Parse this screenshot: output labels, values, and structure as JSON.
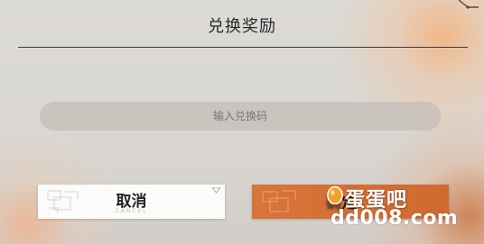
{
  "dialog": {
    "title": "兑换奖励",
    "code_input": {
      "value": "",
      "placeholder": "输入兑换码"
    },
    "cancel_button": {
      "label": "取消",
      "sublabel": "CANCEL"
    },
    "confirm_button": {
      "label_visible": "定",
      "label_obscured": "确"
    }
  },
  "watermark": {
    "logo_text": "蛋蛋吧",
    "url": "dd008.com"
  },
  "colors": {
    "background": "#dad7d3",
    "input_background": "#c4beb8",
    "cancel_background": "#fbfbf9",
    "confirm_background": "#d5703a",
    "title_text": "#2a2a2a"
  },
  "icons": {
    "corner_ornament": "corner-ornament-icon",
    "cancel_pattern": "geometric-pattern-icon",
    "cancel_corner": "triangle-down-icon",
    "confirm_pattern": "geometric-pattern-icon",
    "watermark_egg": "egg-icon"
  }
}
